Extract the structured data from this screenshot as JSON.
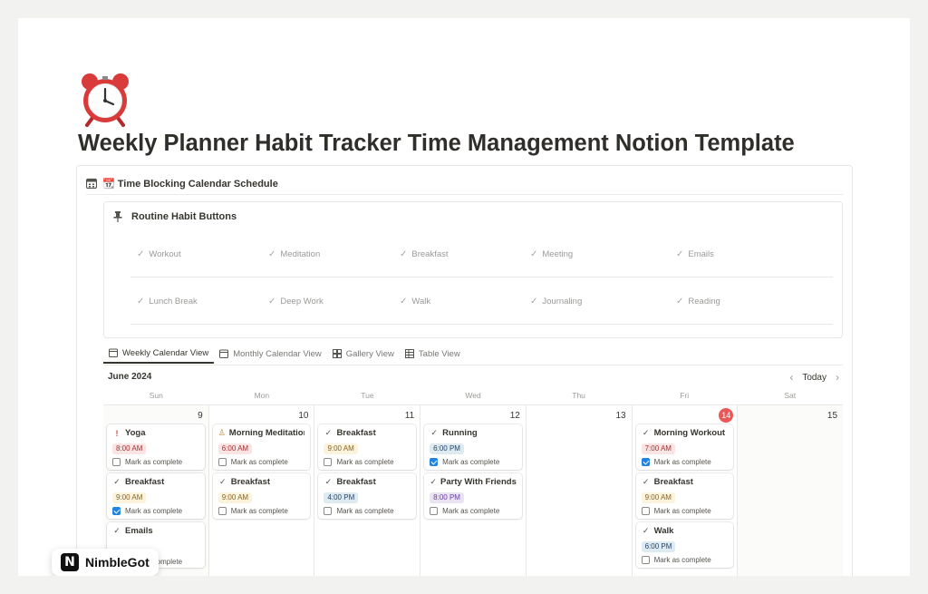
{
  "page": {
    "icon": "alarm-clock-icon",
    "title": "Weekly Planner Habit Tracker Time Management Notion Template"
  },
  "section": {
    "icon": "calendar-icon",
    "title": "📆 Time Blocking Calendar Schedule"
  },
  "routine": {
    "icon": "pushpin-icon",
    "title": "Routine Habit Buttons",
    "buttons": [
      "Workout",
      "Meditation",
      "Breakfast",
      "Meeting",
      "Emails",
      "Lunch Break",
      "Deep Work",
      "Walk",
      "Journaling",
      "Reading"
    ]
  },
  "tabs": [
    {
      "label": "Weekly Calendar View",
      "icon": "calendar-icon",
      "active": true
    },
    {
      "label": "Monthly Calendar View",
      "icon": "calendar-icon",
      "active": false
    },
    {
      "label": "Gallery View",
      "icon": "gallery-icon",
      "active": false
    },
    {
      "label": "Table View",
      "icon": "table-icon",
      "active": false
    }
  ],
  "calendar": {
    "month": "June 2024",
    "today_label": "Today",
    "weekdays": [
      "Sun",
      "Mon",
      "Tue",
      "Wed",
      "Thu",
      "Fri",
      "Sat"
    ],
    "days": [
      {
        "num": "9",
        "today": false,
        "weekend": true,
        "events": [
          {
            "title": "Yoga",
            "icon": "exclamation-icon",
            "time": "8:00 AM",
            "color": "red",
            "done": false,
            "mark": "Mark as complete"
          },
          {
            "title": "Breakfast",
            "icon": "check-icon",
            "time": "9:00 AM",
            "color": "yellow",
            "done": true,
            "mark": "Mark as complete"
          },
          {
            "title": "Emails",
            "icon": "check-icon",
            "time": "",
            "color": "gray",
            "done": false,
            "mark": "Mark as complete"
          }
        ]
      },
      {
        "num": "10",
        "today": false,
        "weekend": false,
        "events": [
          {
            "title": "Morning Meditation",
            "icon": "meditation-icon",
            "time": "6:00 AM",
            "color": "red",
            "done": false,
            "mark": "Mark as complete"
          },
          {
            "title": "Breakfast",
            "icon": "check-icon",
            "time": "9:00 AM",
            "color": "yellow",
            "done": false,
            "mark": "Mark as complete"
          }
        ]
      },
      {
        "num": "11",
        "today": false,
        "weekend": false,
        "events": [
          {
            "title": "Breakfast",
            "icon": "check-icon",
            "time": "9:00 AM",
            "color": "yellow",
            "done": false,
            "mark": "Mark as complete"
          },
          {
            "title": "Breakfast",
            "icon": "check-icon",
            "time": "4:00 PM",
            "color": "blue",
            "done": false,
            "mark": "Mark as complete"
          }
        ]
      },
      {
        "num": "12",
        "today": false,
        "weekend": false,
        "events": [
          {
            "title": "Running",
            "icon": "check-icon",
            "time": "6:00 PM",
            "color": "blue",
            "done": true,
            "mark": "Mark as complete"
          },
          {
            "title": "Party With Friends",
            "icon": "check-icon",
            "time": "8:00 PM",
            "color": "purple",
            "done": false,
            "mark": "Mark as complete"
          }
        ]
      },
      {
        "num": "13",
        "today": false,
        "weekend": false,
        "events": []
      },
      {
        "num": "14",
        "today": true,
        "weekend": false,
        "events": [
          {
            "title": "Morning Workout",
            "icon": "check-icon",
            "time": "7:00 AM",
            "color": "red",
            "done": true,
            "mark": "Mark as complete"
          },
          {
            "title": "Breakfast",
            "icon": "check-icon",
            "time": "9:00 AM",
            "color": "yellow",
            "done": false,
            "mark": "Mark as complete"
          },
          {
            "title": "Walk",
            "icon": "check-icon",
            "time": "6:00 PM",
            "color": "blue",
            "done": false,
            "mark": "Mark as complete"
          }
        ]
      },
      {
        "num": "15",
        "today": false,
        "weekend": true,
        "events": []
      }
    ]
  },
  "tag_colors": {
    "red": {
      "bg": "#fbe4e4",
      "fg": "#9f2f2d"
    },
    "yellow": {
      "bg": "#fbf3db",
      "fg": "#89632a"
    },
    "blue": {
      "bg": "#ddebf1",
      "fg": "#28456c"
    },
    "purple": {
      "bg": "#eae4f2",
      "fg": "#6940a5"
    },
    "gray": {
      "bg": "#ebeced",
      "fg": "#5a5a5a"
    }
  },
  "badge": {
    "logo": "N",
    "name": "NimbleGot"
  }
}
